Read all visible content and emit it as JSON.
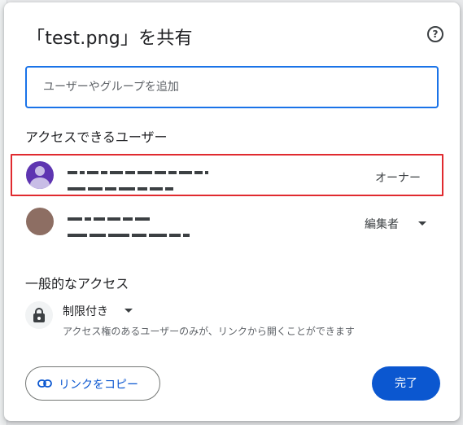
{
  "dialog": {
    "title": "「test.png」を共有",
    "help_icon": "help-circle-icon",
    "add_input_placeholder": "ユーザーやグループを追加",
    "people_heading": "アクセスできるユーザー",
    "people": [
      {
        "role": "オーナー",
        "avatar_color": "#5e35b1"
      },
      {
        "role": "編集者",
        "avatar_color": "#8d6e63"
      }
    ],
    "general_access": {
      "heading": "一般的なアクセス",
      "setting": "制限付き",
      "description": "アクセス権のあるユーザーのみが、リンクから開くことができます"
    },
    "copy_link_label": "リンクをコピー",
    "done_label": "完了"
  },
  "colors": {
    "primary": "#0b57d0",
    "focus": "#1a73e8",
    "highlight_border": "#e02a2f"
  }
}
